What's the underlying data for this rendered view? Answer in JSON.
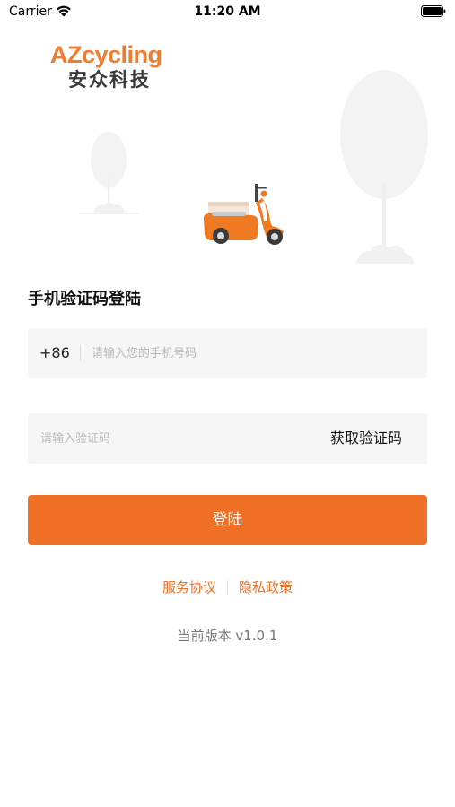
{
  "status_bar": {
    "carrier": "Carrier",
    "time": "11:20 AM"
  },
  "logo": {
    "wordmark": "AZcycling",
    "chinese": "安众科技",
    "brand_color": "#f07c2d"
  },
  "illustration": {
    "icons": [
      "tree-icon",
      "scooter-icon"
    ]
  },
  "login": {
    "title": "手机验证码登陆",
    "country_code": "+86",
    "phone_placeholder": "请输入您的手机号码",
    "code_placeholder": "请输入验证码",
    "get_code_label": "获取验证码",
    "submit_label": "登陆",
    "accent_color": "#f07125"
  },
  "footer": {
    "terms_label": "服务协议",
    "privacy_label": "隐私政策",
    "version": "当前版本 v1.0.1"
  }
}
